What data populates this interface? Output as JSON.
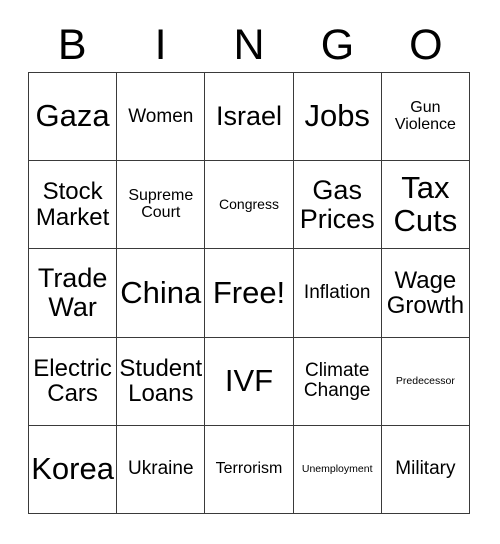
{
  "card": {
    "title": "BINGO",
    "background_color": "#ffffff",
    "text_color": "#000000",
    "border_color": "#3a3a3a"
  },
  "header": {
    "letters": [
      {
        "label": "B"
      },
      {
        "label": "I"
      },
      {
        "label": "N"
      },
      {
        "label": "G"
      },
      {
        "label": "O"
      }
    ]
  },
  "grid": {
    "rows": 5,
    "columns": 5,
    "free_space": "Free!",
    "cells": [
      {
        "label": "Gaza",
        "size": "sz-xxl",
        "column": "B",
        "row": 1
      },
      {
        "label": "Women",
        "size": "sz-md",
        "column": "I",
        "row": 1
      },
      {
        "label": "Israel",
        "size": "sz-xl",
        "column": "N",
        "row": 1
      },
      {
        "label": "Jobs",
        "size": "sz-xxl",
        "column": "G",
        "row": 1
      },
      {
        "label": "Gun\nViolence",
        "size": "sz-sm",
        "column": "O",
        "row": 1
      },
      {
        "label": "Stock\nMarket",
        "size": "sz-lg",
        "column": "B",
        "row": 2
      },
      {
        "label": "Supreme\nCourt",
        "size": "sz-sm",
        "column": "I",
        "row": 2
      },
      {
        "label": "Congress",
        "size": "sz-xs",
        "column": "N",
        "row": 2
      },
      {
        "label": "Gas\nPrices",
        "size": "sz-xl",
        "column": "G",
        "row": 2
      },
      {
        "label": "Tax\nCuts",
        "size": "sz-xxl",
        "column": "O",
        "row": 2
      },
      {
        "label": "Trade\nWar",
        "size": "sz-xl",
        "column": "B",
        "row": 3
      },
      {
        "label": "China",
        "size": "sz-xxl",
        "column": "I",
        "row": 3
      },
      {
        "label": "Free!",
        "size": "sz-xxl",
        "column": "N",
        "row": 3
      },
      {
        "label": "Inflation",
        "size": "sz-md",
        "column": "G",
        "row": 3
      },
      {
        "label": "Wage\nGrowth",
        "size": "sz-lg",
        "column": "O",
        "row": 3
      },
      {
        "label": "Electric\nCars",
        "size": "sz-lg",
        "column": "B",
        "row": 4
      },
      {
        "label": "Student\nLoans",
        "size": "sz-lg",
        "column": "I",
        "row": 4
      },
      {
        "label": "IVF",
        "size": "sz-xxl",
        "column": "N",
        "row": 4
      },
      {
        "label": "Climate\nChange",
        "size": "sz-md",
        "column": "G",
        "row": 4
      },
      {
        "label": "Predecessor",
        "size": "sz-xxs",
        "column": "O",
        "row": 4
      },
      {
        "label": "Korea",
        "size": "sz-xxl",
        "column": "B",
        "row": 5
      },
      {
        "label": "Ukraine",
        "size": "sz-md",
        "column": "I",
        "row": 5
      },
      {
        "label": "Terrorism",
        "size": "sz-sm",
        "column": "N",
        "row": 5
      },
      {
        "label": "Unemployment",
        "size": "sz-xxs",
        "column": "G",
        "row": 5
      },
      {
        "label": "Military",
        "size": "sz-md",
        "column": "O",
        "row": 5
      }
    ]
  }
}
